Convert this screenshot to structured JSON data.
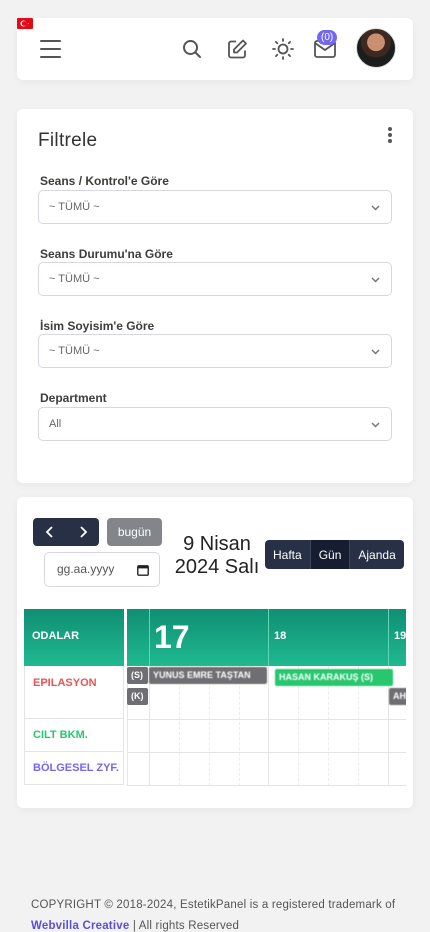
{
  "header": {
    "menu_icon": "hamburger-icon",
    "flag_icon": "turkey-flag-icon",
    "search_icon": "search-icon",
    "edit_icon": "edit-icon",
    "theme_icon": "sun-icon",
    "mail_icon": "mail-icon",
    "mail_count": "(0)",
    "avatar": "user-avatar"
  },
  "filter": {
    "title": "Filtrele",
    "fields": [
      {
        "label": "Seans / Kontrol'e Göre",
        "value": "~ TÜMÜ ~"
      },
      {
        "label": "Seans Durumu'na Göre",
        "value": "~ TÜMÜ ~"
      },
      {
        "label": "İsim Soyisim'e Göre",
        "value": "~ TÜMÜ ~"
      },
      {
        "label": "Department",
        "value": "All"
      }
    ]
  },
  "calendar": {
    "today_label": "bugün",
    "date_placeholder": "gg.aa.yyyy",
    "title_line1": "9 Nisan",
    "title_line2": "2024 Salı",
    "views": [
      "Hafta",
      "Gün",
      "Ajanda"
    ],
    "active_view": "Gün",
    "rooms_header": "ODALAR",
    "rooms": [
      {
        "name": "EPILASYON",
        "color": "#ea5455"
      },
      {
        "name": "CILT BKM.",
        "color": "#28c76f"
      },
      {
        "name": "BÖLGESEL ZYF.",
        "color": "#7367f0"
      }
    ],
    "day_headers": [
      "17",
      "18",
      "19"
    ],
    "events": [
      {
        "label": "(S)",
        "color": "#6e6e73"
      },
      {
        "label": "YUNUS EMRE TAŞTAN",
        "color": "#6e6e73"
      },
      {
        "label": "HASAN KARAKUŞ (S)",
        "color": "#28c76f"
      },
      {
        "label": "(K)",
        "color": "#6e6e73"
      },
      {
        "label": "AH",
        "color": "#6e6e73"
      }
    ]
  },
  "footer": {
    "text_before": "COPYRIGHT © 2018-2024, EstetikPanel is a registered trademark of ",
    "link": "Webvilla Creative",
    "text_after": " | All rights Reserved"
  }
}
